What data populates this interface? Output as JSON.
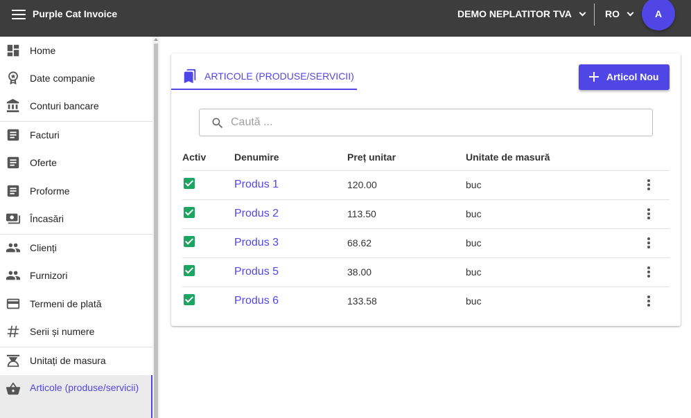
{
  "header": {
    "app_title": "Purple Cat Invoice",
    "company": "DEMO NEPLATITOR TVA",
    "language": "RO",
    "avatar_initial": "A",
    "background": "#3d3d3d",
    "accent": "#5046e5"
  },
  "sidebar": {
    "items": [
      {
        "label": "Home",
        "icon": "dashboard-icon"
      },
      {
        "label": "Date companie",
        "icon": "badge-icon"
      },
      {
        "label": "Conturi bancare",
        "icon": "bank-icon"
      },
      {
        "label": "Facturi",
        "icon": "document-icon"
      },
      {
        "label": "Oferte",
        "icon": "document-icon"
      },
      {
        "label": "Proforme",
        "icon": "document-icon"
      },
      {
        "label": "Încasări",
        "icon": "money-icon"
      },
      {
        "label": "Clienți",
        "icon": "people-icon"
      },
      {
        "label": "Furnizori",
        "icon": "people-icon"
      },
      {
        "label": "Termeni de plată",
        "icon": "credit-card-icon"
      },
      {
        "label": "Serii și numere",
        "icon": "hash-icon"
      },
      {
        "label": "Unitați de masura",
        "icon": "scale-icon"
      },
      {
        "label": "Articole (produse/servicii)",
        "icon": "basket-icon",
        "active": true
      }
    ]
  },
  "main": {
    "tab_label": "ARTICOLE (PRODUSE/SERVICII)",
    "add_button_label": "Articol Nou",
    "search_placeholder": "Caută ...",
    "columns": [
      "Activ",
      "Denumire",
      "Preț unitar",
      "Unitate de masură"
    ],
    "rows": [
      {
        "active": true,
        "name": "Produs 1",
        "price": "120.00",
        "unit": "buc"
      },
      {
        "active": true,
        "name": "Produs 2",
        "price": "113.50",
        "unit": "buc"
      },
      {
        "active": true,
        "name": "Produs 3",
        "price": "68.62",
        "unit": "buc"
      },
      {
        "active": true,
        "name": "Produs 5",
        "price": "38.00",
        "unit": "buc"
      },
      {
        "active": true,
        "name": "Produs 6",
        "price": "133.58",
        "unit": "buc"
      }
    ]
  }
}
